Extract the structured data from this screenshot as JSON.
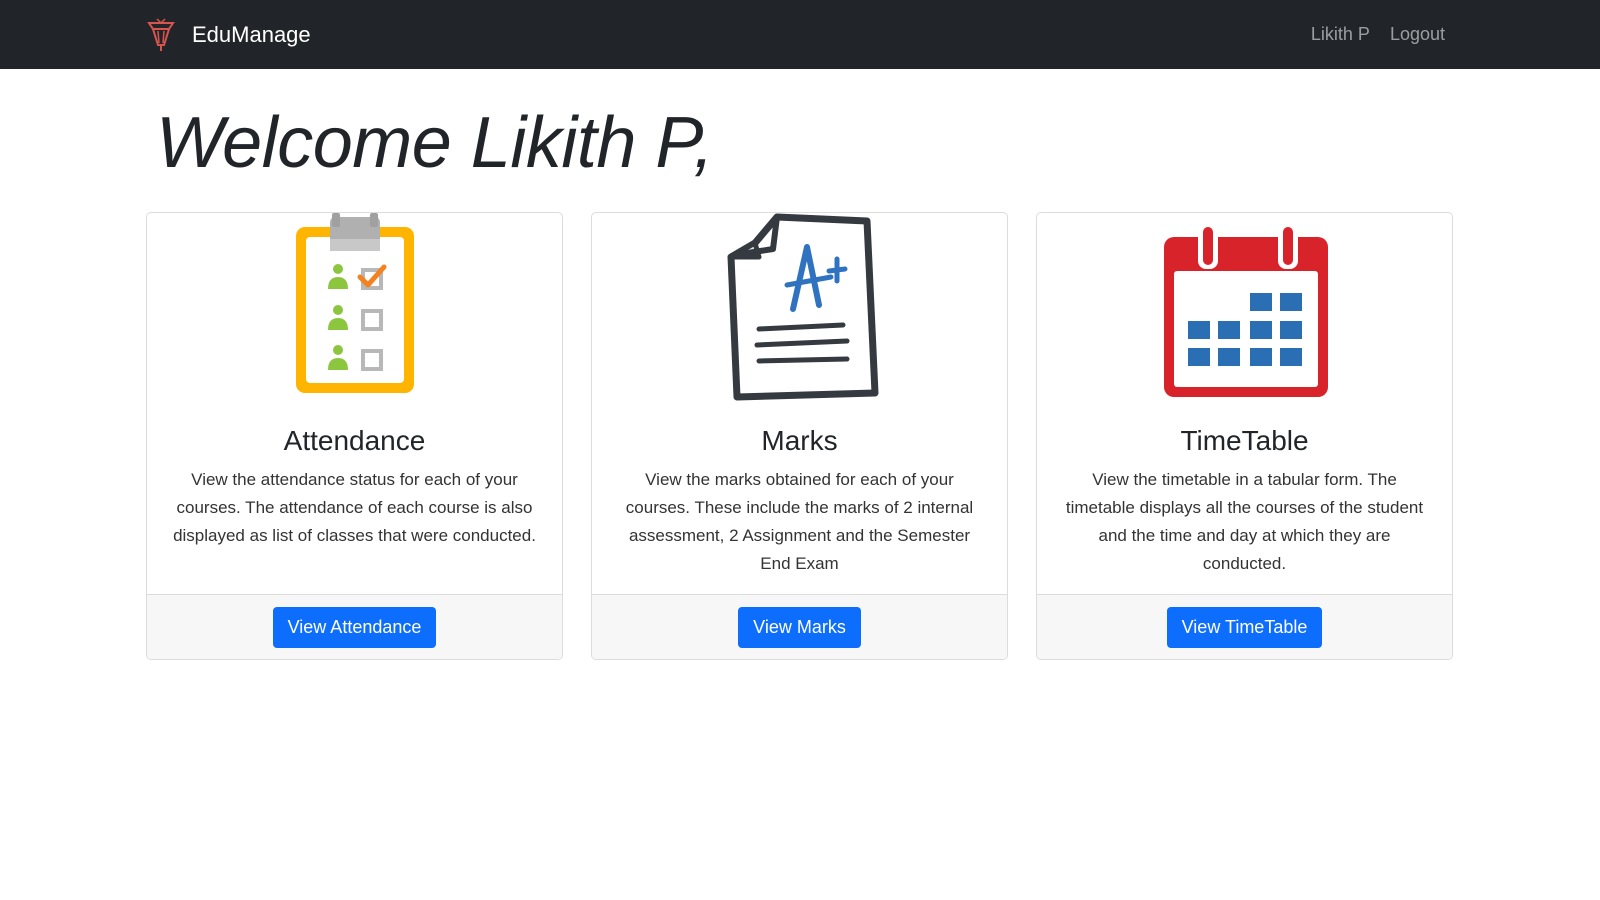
{
  "navbar": {
    "brand": "EduManage",
    "brand_icon": "graduation-torch-logo",
    "user_name": "Likith P",
    "logout_label": "Logout"
  },
  "welcome": {
    "greeting": "Welcome",
    "name": "Likith P,"
  },
  "cards": [
    {
      "icon": "attendance-clipboard-icon",
      "title": "Attendance",
      "text": "View the attendance status for each of your courses. The attendance of each course is also displayed as list of classes that were conducted.",
      "button": "View Attendance"
    },
    {
      "icon": "marks-paper-icon",
      "title": "Marks",
      "text": "View the marks obtained for each of your courses. These include the marks of 2 internal assessment, 2 Assignment and the Semester End Exam",
      "button": "View Marks"
    },
    {
      "icon": "calendar-icon",
      "title": "TimeTable",
      "text": "View the timetable in a tabular form. The timetable displays all the courses of the student and the time and day at which they are conducted.",
      "button": "View TimeTable"
    }
  ],
  "colors": {
    "navbar_bg": "#212529",
    "button_bg": "#0d6efd",
    "clipboard_yellow": "#ffb400",
    "calendar_red": "#d9232a",
    "calendar_blue": "#2a6fb4",
    "marks_blue": "#2f73c0"
  }
}
